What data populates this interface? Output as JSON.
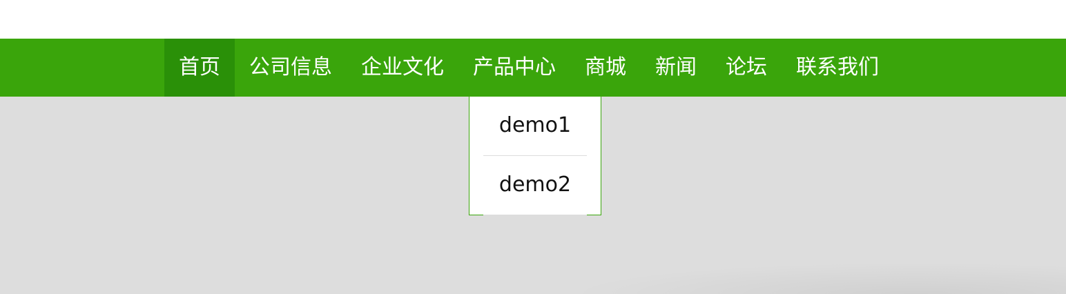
{
  "nav": {
    "items": [
      {
        "label": "首页",
        "active": true
      },
      {
        "label": "公司信息",
        "active": false
      },
      {
        "label": "企业文化",
        "active": false
      },
      {
        "label": "产品中心",
        "active": false
      },
      {
        "label": "商城",
        "active": false
      },
      {
        "label": "新闻",
        "active": false
      },
      {
        "label": "论坛",
        "active": false
      },
      {
        "label": "联系我们",
        "active": false
      }
    ]
  },
  "dropdown": {
    "items": [
      {
        "label": "demo1"
      },
      {
        "label": "demo2"
      }
    ]
  },
  "colors": {
    "nav_bg": "#3aa50b",
    "nav_active_bg": "#2a9008",
    "page_bg": "#dddddd"
  }
}
